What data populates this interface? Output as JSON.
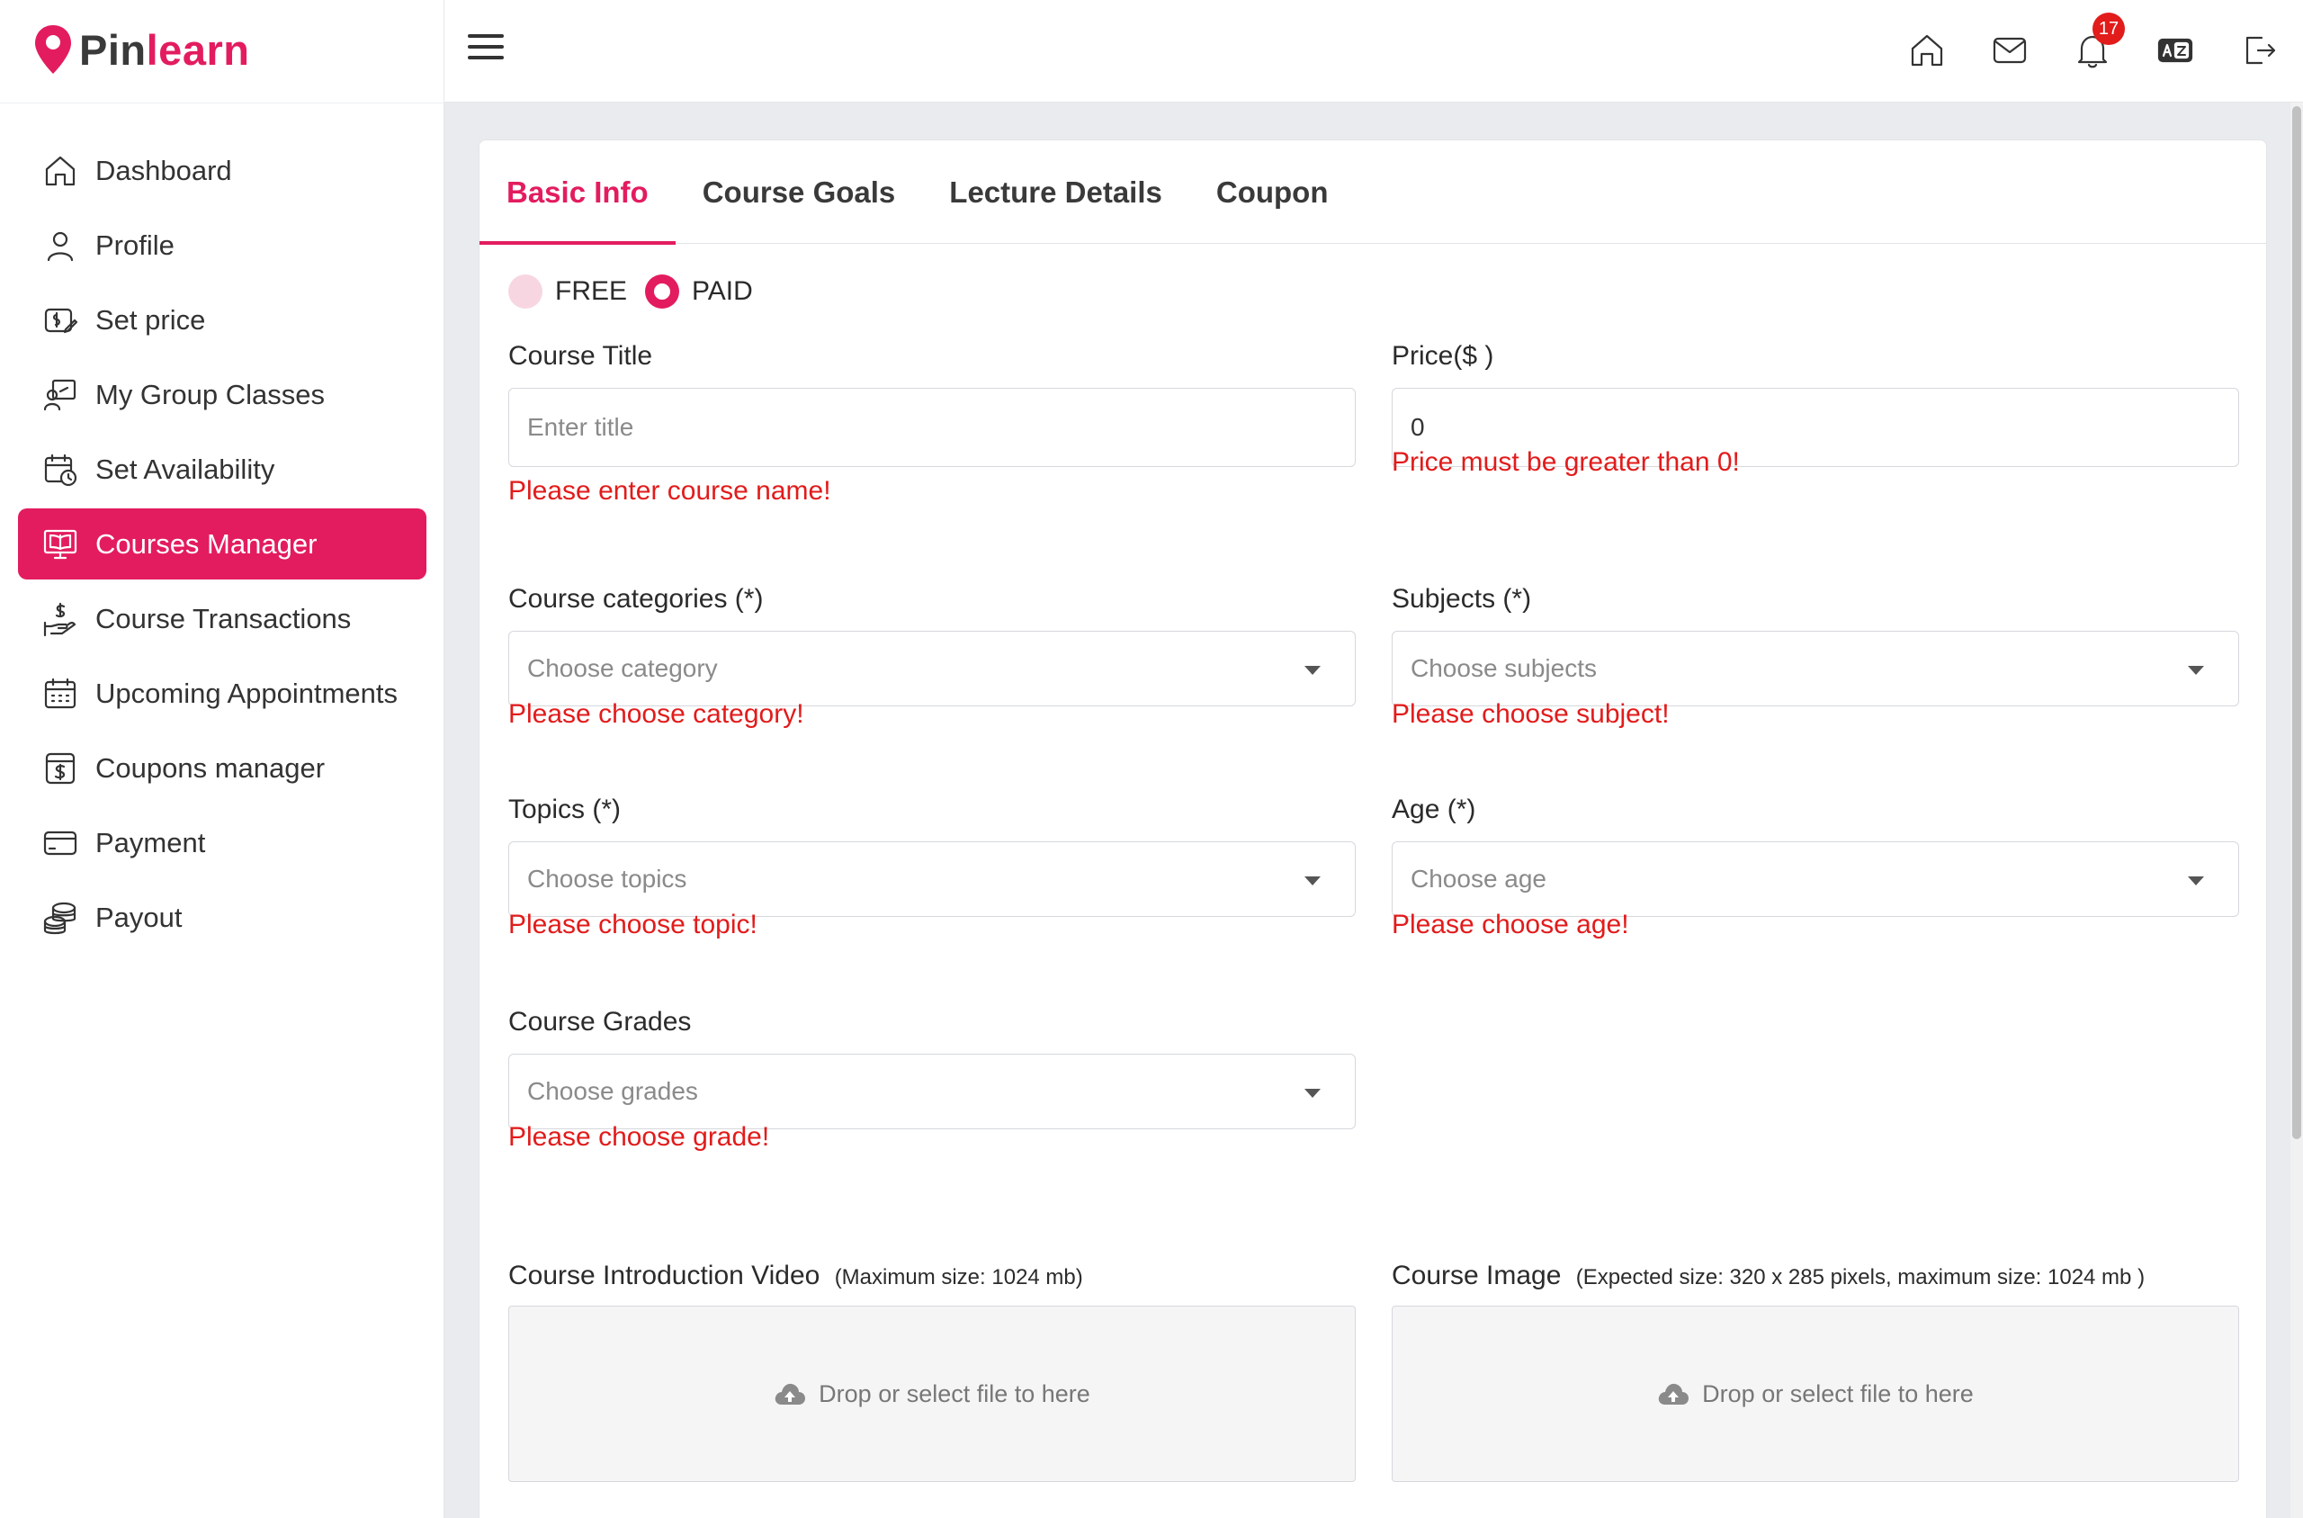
{
  "brand": {
    "pin": "Pin",
    "learn": "learn",
    "accent": "#e31c5f"
  },
  "sidebar": {
    "items": [
      {
        "label": "Dashboard",
        "icon": "home-icon"
      },
      {
        "label": "Profile",
        "icon": "user-icon"
      },
      {
        "label": "Set price",
        "icon": "price-tag-icon"
      },
      {
        "label": "My Group Classes",
        "icon": "teacher-board-icon"
      },
      {
        "label": "Set Availability",
        "icon": "calendar-clock-icon"
      },
      {
        "label": "Courses Manager",
        "icon": "book-screen-icon",
        "active": true
      },
      {
        "label": "Course Transactions",
        "icon": "hand-money-icon"
      },
      {
        "label": "Upcoming Appointments",
        "icon": "calendar-icon"
      },
      {
        "label": "Coupons manager",
        "icon": "coupon-icon"
      },
      {
        "label": "Payment",
        "icon": "credit-card-icon"
      },
      {
        "label": "Payout",
        "icon": "coins-icon"
      }
    ]
  },
  "header": {
    "icons": [
      "home-icon",
      "mail-icon",
      "bell-icon",
      "translate-icon",
      "logout-icon"
    ],
    "notification_count": "17"
  },
  "tabs": [
    {
      "label": "Basic Info",
      "active": true
    },
    {
      "label": "Course Goals"
    },
    {
      "label": "Lecture Details"
    },
    {
      "label": "Coupon"
    }
  ],
  "pricing": {
    "free_label": "FREE",
    "paid_label": "PAID",
    "selected": "PAID"
  },
  "form": {
    "course_title": {
      "label": "Course Title",
      "placeholder": "Enter title",
      "error": "Please enter course name!"
    },
    "price": {
      "label": "Price($ )",
      "value": "0",
      "error": "Price must be greater than 0!"
    },
    "categories": {
      "label": "Course categories (*)",
      "placeholder": "Choose category",
      "error": "Please choose category!"
    },
    "subjects": {
      "label": "Subjects (*)",
      "placeholder": "Choose subjects",
      "error": "Please choose subject!"
    },
    "topics": {
      "label": "Topics (*)",
      "placeholder": "Choose topics",
      "error": "Please choose topic!"
    },
    "age": {
      "label": "Age (*)",
      "placeholder": "Choose age",
      "error": "Please choose age!"
    },
    "grades": {
      "label": "Course Grades",
      "placeholder": "Choose grades",
      "error": "Please choose grade!"
    },
    "intro_video": {
      "label": "Course Introduction Video",
      "hint": "(Maximum size: 1024 mb)",
      "drop_text": "Drop or select file to here"
    },
    "course_image": {
      "label": "Course Image",
      "hint": "(Expected size: 320 x 285 pixels, maximum size: 1024 mb )",
      "drop_text": "Drop or select file to here"
    }
  }
}
